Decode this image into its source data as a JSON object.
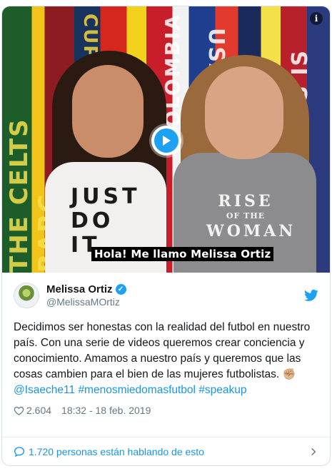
{
  "video": {
    "caption": "Hola! Me llamo Melissa Ortiz",
    "scarf_texts": [
      "THE CELTS BARC",
      "CUP",
      "COLOMBIA",
      "USA",
      "MLS IS"
    ],
    "shirt_left_text": "JUST DO IT",
    "shirt_right_text": {
      "line1": "RISE",
      "line2": "OF THE",
      "line3": "WOMAN"
    },
    "info_icon": "info-icon",
    "play_icon": "play-icon"
  },
  "author": {
    "display_name": "Melissa Ortiz",
    "handle": "@MelissaMOrtiz",
    "verified_icon": "verified-badge-icon",
    "logo_icon": "twitter-bird-icon"
  },
  "tweet": {
    "body": "Decidimos ser honestas con la realidad del futbol en nuestro país. Con una serie de videos queremos crear conciencia y conocimiento. Amamos a nuestro país y queremos que las cosas cambien para el bien de las mujeres futbolistas. ",
    "fist_emoji": "✊🏼",
    "mention": "@Isaeche11",
    "hashtag1": "#menosmiedomasfutbol",
    "hashtag2": "#speakup"
  },
  "meta": {
    "likes": "2.604",
    "timestamp": "18:32 - 18 feb. 2019"
  },
  "footer": {
    "text": "1.720 personas están hablando de esto"
  },
  "colors": {
    "link": "#1b95e0",
    "twitter_blue": "#1da1f2",
    "secondary_text": "#657786"
  }
}
